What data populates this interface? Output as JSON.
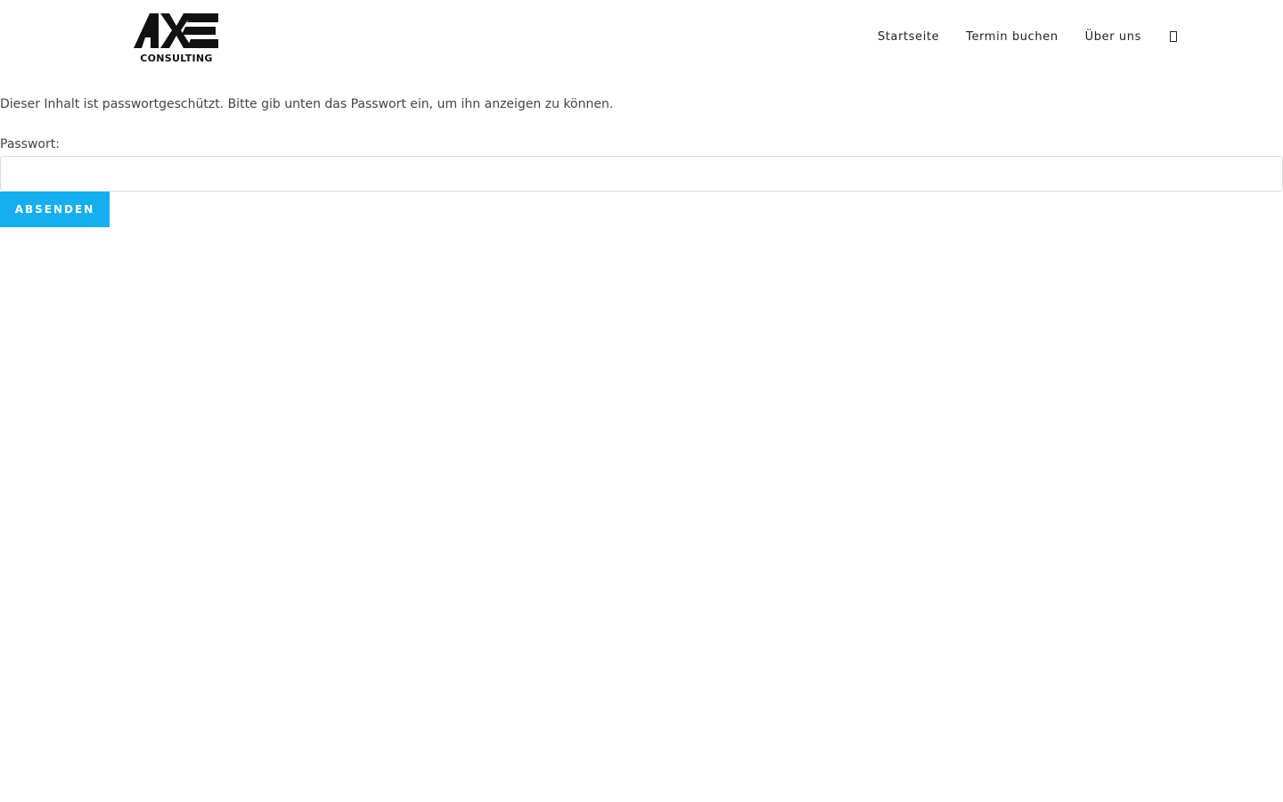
{
  "brand": {
    "logo_text": "AXE",
    "logo_subtext": "CONSULTING"
  },
  "nav": {
    "items": [
      {
        "label": "Startseite"
      },
      {
        "label": "Termin buchen"
      },
      {
        "label": "Über uns"
      }
    ],
    "search_icon": "search-icon"
  },
  "content": {
    "notice": "Dieser Inhalt ist passwortgeschützt. Bitte gib unten das Passwort ein, um ihn anzeigen zu können.",
    "password_label": "Passwort:",
    "password_value": "",
    "submit_label": "Absenden"
  },
  "colors": {
    "accent": "#13aff0",
    "text": "#333333"
  }
}
